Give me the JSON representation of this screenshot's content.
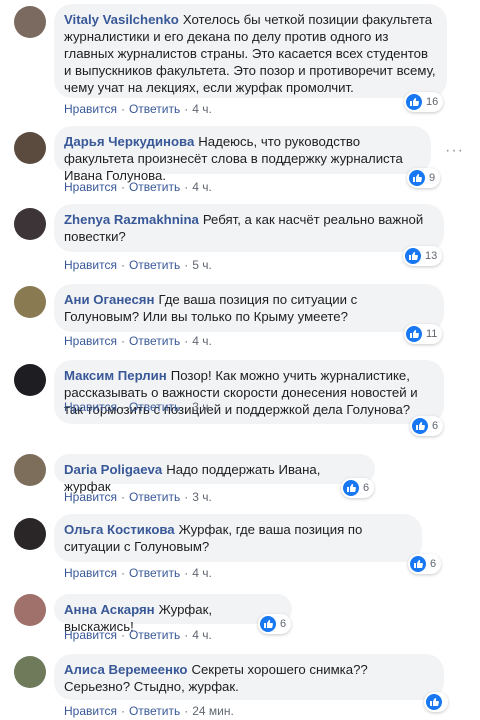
{
  "actions": {
    "like": "Нравится",
    "reply": "Ответить",
    "sep": "·"
  },
  "colors": {
    "author": "#385898",
    "bubble": "#f2f3f5",
    "like": "#1877f2"
  },
  "comments": [
    {
      "author": "Vitaly Vasilchenko",
      "text": "Хотелось бы четкой позиции факультета журналистики и его декана по делу против одного из главных журналистов страны. Это касается всех студентов и выпускников факультета. Это позор и противоречит всему, чему учат на лекциях, если журфак промолчит.",
      "time": "4 ч.",
      "likes": "16",
      "avatar": "#7a6a60"
    },
    {
      "author": "Дарья Черкудинова",
      "text": "Надеюсь, что руководство факультета произнесёт слова в поддержку журналиста Ивана Голунова.",
      "time": "4 ч.",
      "likes": "9",
      "avatar": "#5b4a3e"
    },
    {
      "author": "Zhenya Razmakhnina",
      "text": "Ребят, а как насчёт реально важной повестки?",
      "time": "5 ч.",
      "likes": "13",
      "avatar": "#3c3436"
    },
    {
      "author": "Ани Оганесян",
      "text": "Где ваша позиция по ситуации с Голуновым? Или вы только по Крыму умеете?",
      "time": "4 ч.",
      "likes": "11",
      "avatar": "#8a7a52"
    },
    {
      "author": "Максим Перлин",
      "text": "Позор! Как можно учить журналистике, рассказывать о важности скорости донесения новостей и так тормозить с позицией и поддержкой дела Голунова?",
      "time": "3 ч.",
      "likes": "6",
      "avatar": "#1e1e22"
    },
    {
      "author": "Daria Poligaeva",
      "text": "Надо поддержать Ивана, журфак",
      "time": "3 ч.",
      "likes": "6",
      "avatar": "#7d6e5c"
    },
    {
      "author": "Ольга Костикова",
      "text": "Журфак, где ваша позиция по ситуации с Голуновым?",
      "time": "4 ч.",
      "likes": "6",
      "avatar": "#2a2628"
    },
    {
      "author": "Анна Аскарян",
      "text": "Журфак, выскажись!",
      "time": "4 ч.",
      "likes": "6",
      "avatar": "#a0716a"
    },
    {
      "author": "Алиса Веремеенко",
      "text": "Секреты хорошего снимка?? Серьезно? Стыдно, журфак.",
      "time": "24 мин.",
      "likes": "",
      "avatar": "#6e7a5a"
    }
  ],
  "more_icon": "ellipsis-icon"
}
